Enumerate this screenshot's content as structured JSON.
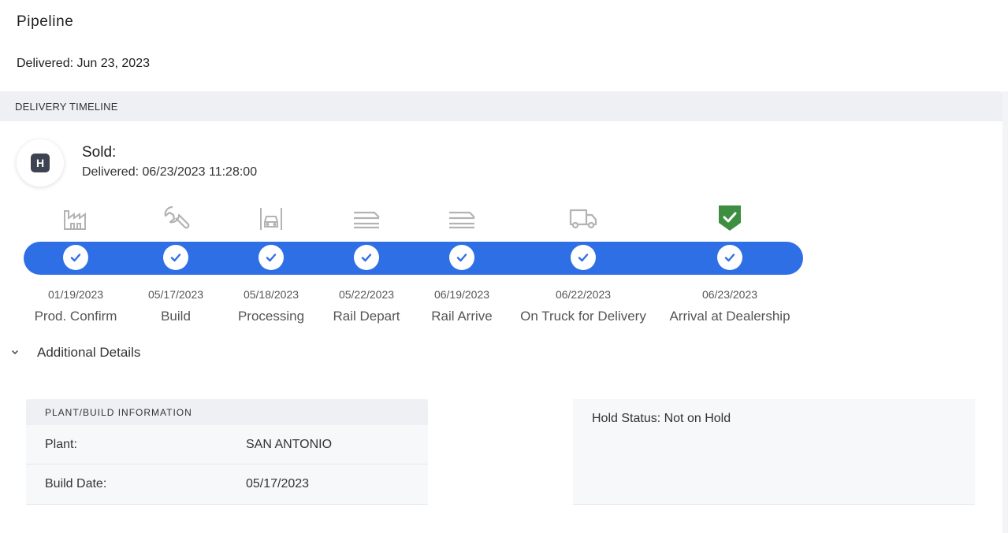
{
  "header": {
    "title": "Pipeline",
    "delivered_summary": "Delivered: Jun 23, 2023"
  },
  "timeline_section": {
    "title": "DELIVERY TIMELINE",
    "avatar_letter": "H",
    "status_title": "Sold:",
    "status_sub": "Delivered: 06/23/2023 11:28:00",
    "accent_color": "#2f6fe6",
    "complete_color": "#3e8e41",
    "stages": [
      {
        "icon": "factory-icon",
        "date": "01/19/2023",
        "label": "Prod. Confirm"
      },
      {
        "icon": "wrench-icon",
        "date": "05/17/2023",
        "label": "Build"
      },
      {
        "icon": "car-lift-icon",
        "date": "05/18/2023",
        "label": "Processing"
      },
      {
        "icon": "railcar-icon",
        "date": "05/22/2023",
        "label": "Rail Depart"
      },
      {
        "icon": "railcar-icon",
        "date": "06/19/2023",
        "label": "Rail Arrive"
      },
      {
        "icon": "truck-icon",
        "date": "06/22/2023",
        "label": "On Truck for Delivery"
      },
      {
        "icon": "shield-check-icon",
        "date": "06/23/2023",
        "label": "Arrival at Dealership"
      }
    ]
  },
  "additional_details": {
    "toggle_label": "Additional Details",
    "plant_card": {
      "title": "PLANT/BUILD INFORMATION",
      "rows": [
        {
          "key": "Plant:",
          "value": "SAN ANTONIO"
        },
        {
          "key": "Build Date:",
          "value": "05/17/2023"
        }
      ]
    },
    "hold_status": "Hold Status: Not on Hold"
  }
}
